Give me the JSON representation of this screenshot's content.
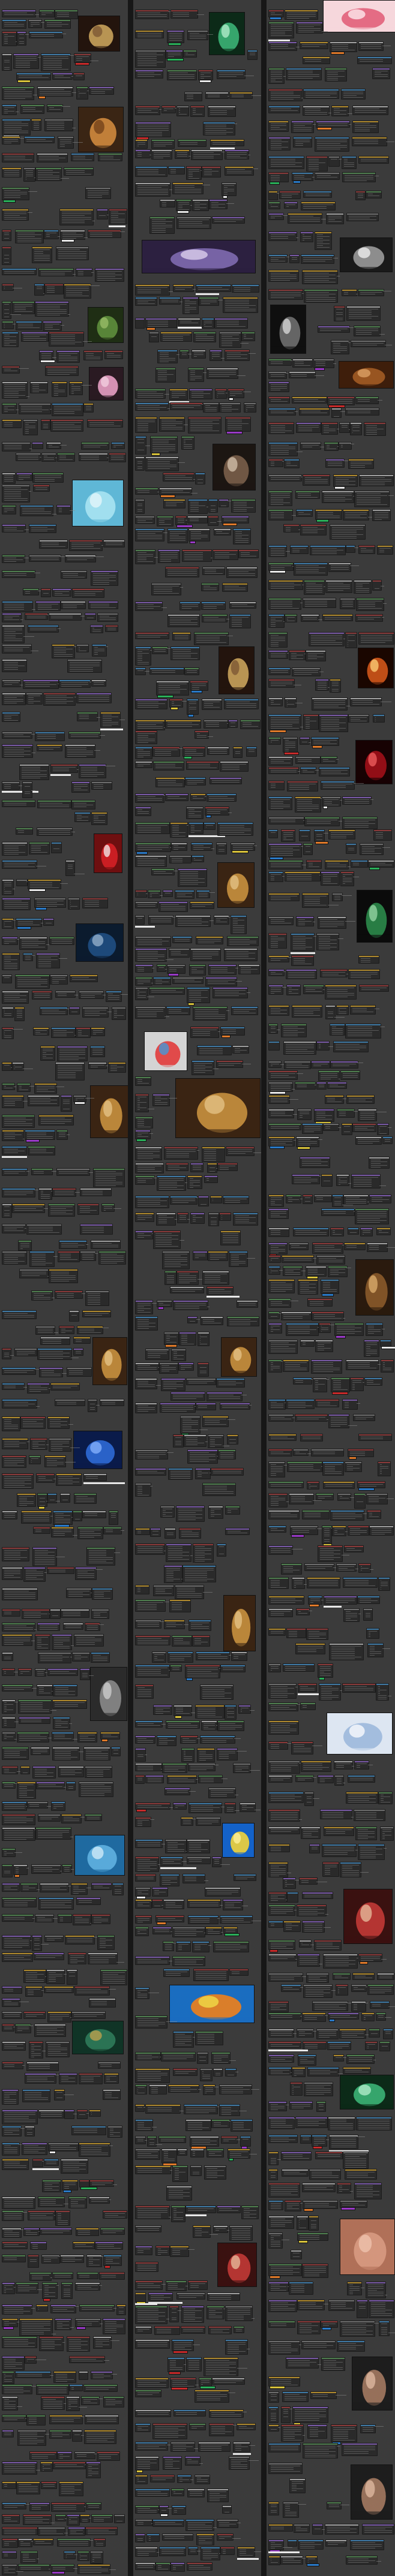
{
  "canvas": {
    "header_title": "",
    "background_color": "#171717",
    "panel_color": "#3b3b3b",
    "node_color": "#2a2a2a"
  },
  "columns": [
    {
      "name": "column-left"
    },
    {
      "name": "column-middle"
    },
    {
      "name": "column-right"
    }
  ],
  "node_header_colors": [
    "#b08a2e",
    "#3f7aa6",
    "#6e6e6e",
    "#8b3a3a",
    "#4f7f4f",
    "#7a5aa8",
    "#a0a0a0"
  ],
  "previews": [
    {
      "name": "watch-preview",
      "icon": "watch"
    },
    {
      "name": "perfume-bottles-preview",
      "icon": "bottles"
    },
    {
      "name": "green-leaves-preview",
      "icon": "leaves"
    },
    {
      "name": "pink-lotus-preview",
      "icon": "lotus"
    },
    {
      "name": "cyan-abstract-preview",
      "icon": "abstract"
    },
    {
      "name": "red-can-preview",
      "icon": "can"
    },
    {
      "name": "dark-pen-preview",
      "icon": "pen"
    },
    {
      "name": "bronze-bottle-preview",
      "icon": "bottle"
    },
    {
      "name": "amber-bottle-preview",
      "icon": "bottle"
    },
    {
      "name": "smartphone-preview",
      "icon": "phone"
    },
    {
      "name": "metal-object-preview",
      "icon": "metal"
    },
    {
      "name": "blue-shelf-preview",
      "icon": "shelf"
    },
    {
      "name": "teapot-preview",
      "icon": "teapot"
    },
    {
      "name": "figurine-preview",
      "icon": "figurine"
    },
    {
      "name": "fabric-preview",
      "icon": "fabric"
    },
    {
      "name": "stone-pillars-preview",
      "icon": "pillars"
    },
    {
      "name": "smartwatch-preview",
      "icon": "watch"
    },
    {
      "name": "gold-bottle-preview",
      "icon": "bottle"
    },
    {
      "name": "colored-spheres-preview",
      "icon": "spheres"
    },
    {
      "name": "red-bottle-preview",
      "icon": "bottle"
    },
    {
      "name": "pink-perfume-preview",
      "icon": "bottle"
    },
    {
      "name": "yellow-bottle-preview",
      "icon": "bottle"
    },
    {
      "name": "lemon-preview",
      "icon": "lemon"
    },
    {
      "name": "colored-pencils-preview",
      "icon": "pencils"
    },
    {
      "name": "cosmetic-jars-preview",
      "icon": "jars"
    },
    {
      "name": "pink-floral-preview",
      "icon": "floral"
    },
    {
      "name": "silver-sphere-preview",
      "icon": "sphere"
    },
    {
      "name": "skull-figure-preview",
      "icon": "skull"
    },
    {
      "name": "wood-grain-preview",
      "icon": "wood"
    },
    {
      "name": "fire-preview",
      "icon": "fire"
    },
    {
      "name": "red-smoke-preview",
      "icon": "smoke"
    },
    {
      "name": "green-dragon-preview",
      "icon": "dragon"
    },
    {
      "name": "wooden-vase-preview",
      "icon": "vase"
    },
    {
      "name": "crystal-preview",
      "icon": "crystal"
    },
    {
      "name": "red-cosmetics-preview",
      "icon": "jars"
    },
    {
      "name": "jade-figurine-preview",
      "icon": "figurine"
    },
    {
      "name": "skin-back-preview",
      "icon": "skin"
    },
    {
      "name": "face-portrait-preview",
      "icon": "face"
    },
    {
      "name": "male-head-preview",
      "icon": "face"
    }
  ]
}
